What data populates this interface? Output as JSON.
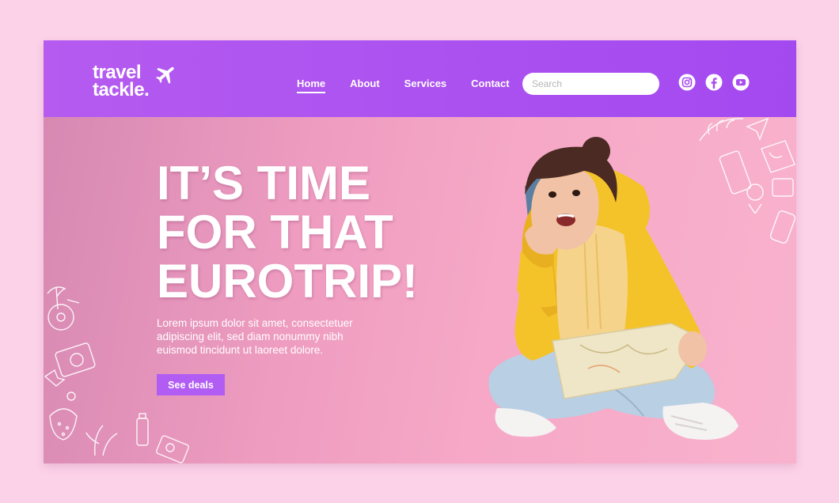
{
  "brand": {
    "line1": "travel",
    "line2": "tackle",
    "dot": "."
  },
  "nav": {
    "items": [
      {
        "label": "Home",
        "active": true
      },
      {
        "label": "About",
        "active": false
      },
      {
        "label": "Services",
        "active": false
      },
      {
        "label": "Contact",
        "active": false
      }
    ]
  },
  "search": {
    "placeholder": "Search",
    "value": ""
  },
  "social": [
    "instagram-icon",
    "facebook-icon",
    "youtube-icon"
  ],
  "hero": {
    "title_lines": [
      "IT’S TIME",
      "FOR THAT",
      "EUROTRIP!"
    ],
    "body_lines": [
      "Lorem ipsum dolor sit amet, consectetuer",
      "adipiscing elit, sed diam nonummy nibh",
      "euismod tincidunt ut laoreet dolore."
    ],
    "cta_label": "See deals"
  },
  "colors": {
    "page_bg": "#fcd2e8",
    "header": "#a349f0",
    "accent": "#b15cf3",
    "hero_bg": "#f0a2c4"
  }
}
